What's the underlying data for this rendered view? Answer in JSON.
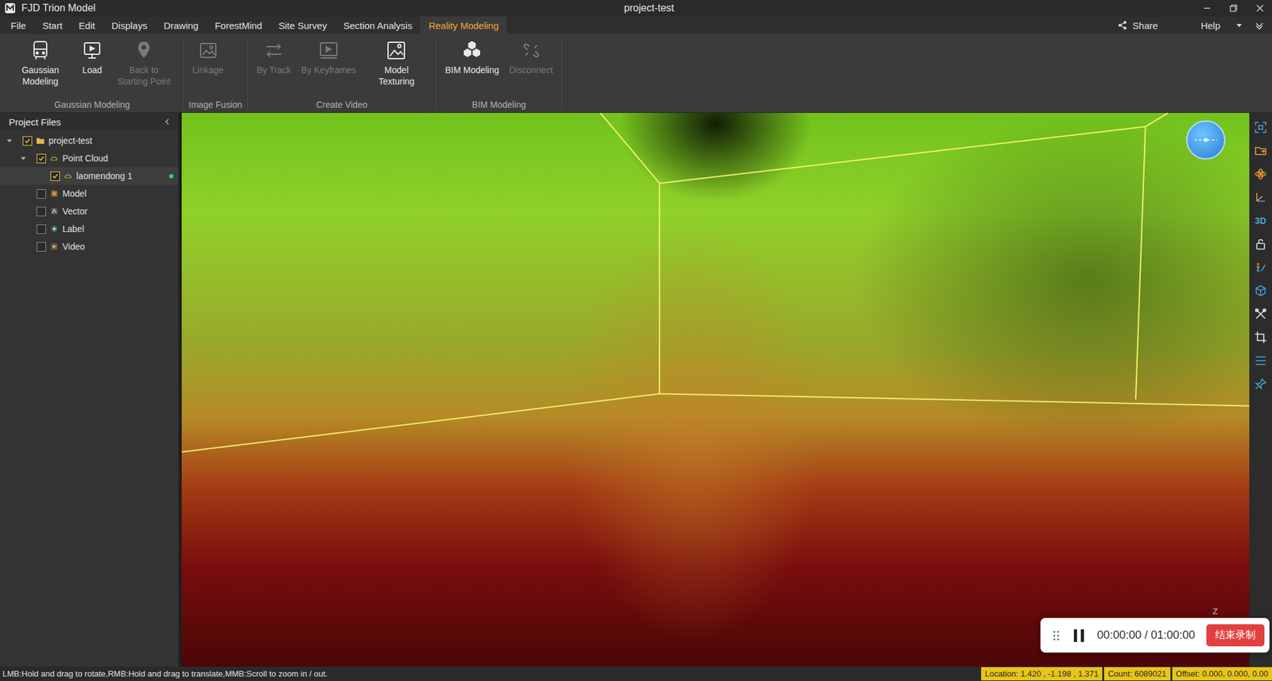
{
  "window": {
    "app_name": "FJD Trion Model",
    "title": "project-test"
  },
  "menu": [
    {
      "label": "File",
      "selected": false
    },
    {
      "label": "Start",
      "selected": false
    },
    {
      "label": "Edit",
      "selected": false
    },
    {
      "label": "Displays",
      "selected": false
    },
    {
      "label": "Drawing",
      "selected": false
    },
    {
      "label": "ForestMind",
      "selected": false
    },
    {
      "label": "Site Survey",
      "selected": false
    },
    {
      "label": "Section Analysis",
      "selected": false
    },
    {
      "label": "Reality Modeling",
      "selected": true
    }
  ],
  "menu_right": {
    "share": "Share",
    "help": "Help"
  },
  "ribbon": [
    {
      "label": "Gaussian Modeling",
      "buttons": [
        {
          "label": "Gaussian Modeling",
          "kind": "gaussian",
          "disabled": false
        },
        {
          "label": "Load",
          "kind": "load",
          "disabled": false
        },
        {
          "label": "Back to Starting Point",
          "kind": "pin",
          "disabled": true
        }
      ]
    },
    {
      "label": "Image Fusion",
      "buttons": [
        {
          "label": "Linkage",
          "kind": "linkage",
          "disabled": true
        }
      ]
    },
    {
      "label": "Create Video",
      "buttons": [
        {
          "label": "By Track",
          "kind": "track",
          "disabled": true
        },
        {
          "label": "By Keyframes",
          "kind": "keyframes",
          "disabled": true
        },
        {
          "label": "Model Texturing",
          "kind": "texturing",
          "disabled": false
        }
      ]
    },
    {
      "label": "BIM Modeling",
      "buttons": [
        {
          "label": "BIM Modeling",
          "kind": "bim",
          "disabled": false
        },
        {
          "label": "Disconnect",
          "kind": "disconnect",
          "disabled": true
        }
      ]
    }
  ],
  "project_panel": {
    "title": "Project Files",
    "tree": [
      {
        "label": "project-test",
        "depth": 0,
        "kind": "folder",
        "has_children": true,
        "expanded": true,
        "checked": true,
        "selected": false,
        "loaded": false
      },
      {
        "label": "Point Cloud",
        "depth": 1,
        "kind": "pointcloud",
        "has_children": true,
        "expanded": true,
        "checked": true,
        "selected": false,
        "loaded": false
      },
      {
        "label": "laomendong 1",
        "depth": 2,
        "kind": "cloud",
        "has_children": false,
        "expanded": false,
        "checked": true,
        "selected": true,
        "loaded": true
      },
      {
        "label": "Model",
        "depth": 1,
        "kind": "model",
        "has_children": false,
        "expanded": false,
        "checked": false,
        "selected": false,
        "loaded": false
      },
      {
        "label": "Vector",
        "depth": 1,
        "kind": "vector",
        "has_children": false,
        "expanded": false,
        "checked": false,
        "selected": false,
        "loaded": false
      },
      {
        "label": "Label",
        "depth": 1,
        "kind": "label",
        "has_children": false,
        "expanded": false,
        "checked": false,
        "selected": false,
        "loaded": false
      },
      {
        "label": "Video",
        "depth": 1,
        "kind": "video",
        "has_children": false,
        "expanded": false,
        "checked": false,
        "selected": false,
        "loaded": false
      }
    ]
  },
  "right_toolbar": [
    {
      "kind": "fit",
      "label": ""
    },
    {
      "kind": "folder",
      "label": ""
    },
    {
      "kind": "orbit",
      "label": ""
    },
    {
      "kind": "axes",
      "label": ""
    },
    {
      "kind": "text",
      "label": "3D"
    },
    {
      "kind": "lock",
      "label": ""
    },
    {
      "kind": "palette",
      "label": ""
    },
    {
      "kind": "cube",
      "label": ""
    },
    {
      "kind": "tools",
      "label": ""
    },
    {
      "kind": "crop",
      "label": ""
    },
    {
      "kind": "list",
      "label": ""
    },
    {
      "kind": "pin",
      "label": ""
    }
  ],
  "viewport": {
    "axis_label": "Z"
  },
  "recorder": {
    "time": "00:00:00 / 01:00:00",
    "stop_label": "结束录制"
  },
  "status_bar": {
    "hint": "LMB:Hold and drag to rotate,RMB:Hold and drag to translate,MMB:Scroll to zoom in / out.",
    "location": "Location: 1.420 , -1.198 , 1.371",
    "count": "Count: 6089021",
    "offset": "Offset: 0.000, 0.000, 0.00"
  }
}
